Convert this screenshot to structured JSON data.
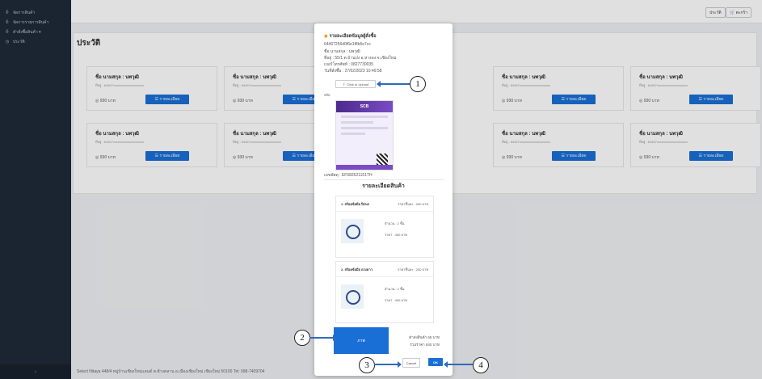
{
  "sidebar": {
    "items": [
      {
        "icon": "user-icon",
        "label": "จัดการสินค้า"
      },
      {
        "icon": "user-icon",
        "label": "จัดการรายการสินค้า"
      },
      {
        "icon": "user-icon",
        "label": "คำสั่งซื้อสินค้า ▾"
      },
      {
        "icon": "clock-icon",
        "label": "ประวัติ"
      }
    ],
    "collapse": "‹"
  },
  "topbar": {
    "btn1": "ประวัติ",
    "btn2": "🛒 ตะกร้า"
  },
  "page": {
    "title": "ประวัติ"
  },
  "cards": [
    {
      "name": "ชื่อ นามสกุล : นพวุฒิ",
      "addr": "ที่อยู่ : 64467xxxxxxxxxxxxxxxxxxx",
      "price": "◎ 930 บาท",
      "btn": "☰ รายละเอียด"
    },
    {
      "name": "ชื่อ นามสกุล : นพวุฒิ",
      "addr": "ที่อยู่ : 64467xxxxxxxxxxxxxxxxxxx",
      "price": "◎ 930 บาท",
      "btn": "☰ รายละเอียด"
    },
    {
      "name": "ชื่อ นามสกุล : นพวุฒิ",
      "addr": "ที่อยู่ : 64467xxxxxxxxxxxxxxxxxxx",
      "price": "◎ 930 บาท",
      "btn": "☰ รายละเอียด"
    },
    {
      "name": "ชื่อ นามสกุล : นพวุฒิ",
      "addr": "ที่อยู่ : 64467xxxxxxxxxxxxxxxxxxx",
      "price": "◎ 930 บาท",
      "btn": "☰ รายละเอียด"
    },
    {
      "name": "ชื่อ นามสกุล : นพวุฒิ",
      "addr": "ที่อยู่ : 64467xxxxxxxxxxxxxxxxxxx",
      "price": "◎ 930 บาท",
      "btn": "☰ รายละเอียด"
    },
    {
      "name": "ชื่อ นามสกุล : นพวุฒิ",
      "addr": "ที่อยู่ : 64467xxxxxxxxxxxxxxxxxxx",
      "price": "◎ 930 บาท",
      "btn": "☰ รายละเอียด"
    },
    {
      "name": "ชื่อ นามสกุล : นพวุฒิ",
      "addr": "ที่อยู่ : 64467xxxxxxxxxxxxxxxxxxx",
      "price": "◎ 930 บาท",
      "btn": "☰ รายละเอียด"
    },
    {
      "name": "ชื่อ นามสกุล : นพวุฒิ",
      "addr": "ที่อยู่ : 64467xxxxxxxxxxxxxxxxxxx",
      "price": "◎ 930 บาท",
      "btn": "☰ รายละเอียด"
    }
  ],
  "footer": "Select Nitaya 448/4 หมู่บ้านเชียงใหม่แลนด์ ต.ช้างคลาน อ.เมืองเชียงใหม่ เชียงใหม่ 50100 Tel: 098-7409704",
  "modal": {
    "title": "รายละเอียดข้อมูลผู้สั่งซื้อ",
    "order_id": "64467256d0f6e1f8b5e7cc",
    "name": "ชื่อ นามสกุล : นพวุฒิ",
    "address": "ที่อยู่ : 55/1 ต.บ้านปง อ.หางดง จ.เชียงใหม่",
    "phone": "เบอร์โทรศัพท์ : 0827730035",
    "date": "วันที่สั่งซื้อ : 27/02/2023 10:49:58",
    "upload_label": "Click to Upload",
    "slip_caption": "สลิป",
    "slip_bank": "SCB",
    "tracking": "เลขพัสดุ : EF582621151TH",
    "section_title": "รายละเอียดสินค้า",
    "products": [
      {
        "name": "1. สร้อยข้อมือ ปีกนก",
        "unit": "ราคาชิ้นละ : 200 บาท",
        "qty": "จำนวน : 2 ชิ้น",
        "total": "ราคา : 400 บาท"
      },
      {
        "name": "2. สร้อยข้อมือ ดวงดาว",
        "unit": "ราคาชิ้นละ : 200 บาท",
        "qty": "จำนวน : 2 ชิ้น",
        "total": "ราคา : 400 บาท"
      }
    ],
    "pay_label": "ภาพ",
    "shipping": "ค่าส่งสินค้า 65 บาท",
    "total": "รวมราคา 930 บาท",
    "cancel": "Cancel",
    "ok": "OK"
  },
  "callouts": [
    "1",
    "2",
    "3",
    "4"
  ],
  "colors": {
    "accent": "#1a6fd6",
    "sidebar": "#1f2b3a",
    "arrow": "#2e6bb8"
  }
}
